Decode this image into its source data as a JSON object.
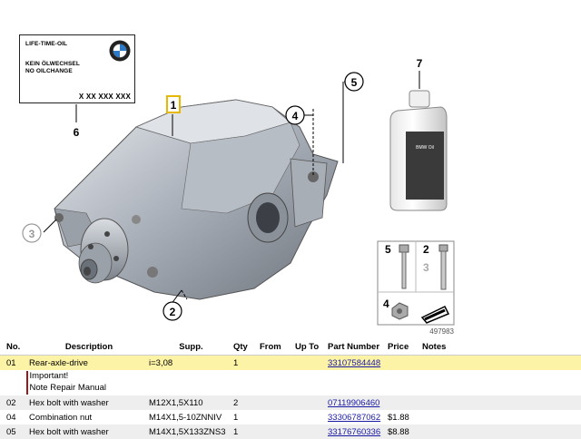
{
  "label": {
    "line1": "LIFE-TIME-OIL",
    "line2": "KEIN ÖLWECHSEL",
    "line3": "NO OILCHANGE",
    "number": "X XX XXX XXX"
  },
  "callouts": {
    "c1": "1",
    "c2": "2",
    "c3": "3",
    "c4": "4",
    "c5": "5",
    "c6": "6",
    "c7": "7"
  },
  "inset": {
    "c5": "5",
    "c2": "2",
    "c3": "3",
    "c4": "4"
  },
  "bottle_label": "BMW Oil",
  "diagram_id": "497983",
  "table": {
    "headers": {
      "no": "No.",
      "desc": "Description",
      "supp": "Supp.",
      "qty": "Qty",
      "from": "From",
      "upto": "Up To",
      "pn": "Part Number",
      "price": "Price",
      "notes": "Notes"
    },
    "rows": [
      {
        "no": "01",
        "desc": "Rear-axle-drive",
        "supp": "i=3,08",
        "qty": "1",
        "pn": "33107584448",
        "price": ""
      },
      {
        "no": "02",
        "desc": "Hex bolt with washer",
        "supp": "M12X1,5X110",
        "qty": "2",
        "pn": "07119906460",
        "price": ""
      },
      {
        "no": "04",
        "desc": "Combination nut",
        "supp": "M14X1,5-10ZNNIV",
        "qty": "1",
        "pn": "33306787062",
        "price": "$1.88"
      },
      {
        "no": "05",
        "desc": "Hex bolt with washer",
        "supp": "M14X1,5X133ZNS3",
        "qty": "1",
        "pn": "33176760336",
        "price": "$8.88"
      }
    ],
    "note": {
      "line1": "Important!",
      "line2": "Note Repair Manual"
    }
  },
  "colors": {
    "highlight": "#fdf3a6",
    "link": "#1a1aa6",
    "callout_box": "#e6b800"
  }
}
